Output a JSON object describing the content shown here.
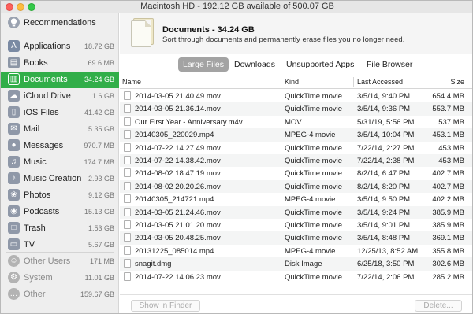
{
  "window": {
    "title": "Macintosh HD - 192.12 GB available of 500.07 GB"
  },
  "sidebar": {
    "recommendations": {
      "label": "Recommendations",
      "icon": "lightbulb-icon"
    },
    "items": [
      {
        "label": "Applications",
        "size": "18.72 GB",
        "icon": "applications-icon",
        "color": "#7a8aa3"
      },
      {
        "label": "Books",
        "size": "69.6 MB",
        "icon": "books-icon",
        "color": "#8c96a6"
      },
      {
        "label": "Documents",
        "size": "34.24 GB",
        "icon": "documents-icon",
        "color": "#ffffff"
      },
      {
        "label": "iCloud Drive",
        "size": "1.6 GB",
        "icon": "cloud-icon",
        "color": "#8f98a8"
      },
      {
        "label": "iOS Files",
        "size": "41.42 GB",
        "icon": "phone-icon",
        "color": "#8f98a8"
      },
      {
        "label": "Mail",
        "size": "5.35 GB",
        "icon": "mail-icon",
        "color": "#8f98a8"
      },
      {
        "label": "Messages",
        "size": "970.7 MB",
        "icon": "messages-icon",
        "color": "#8f98a8"
      },
      {
        "label": "Music",
        "size": "174.7 MB",
        "icon": "music-icon",
        "color": "#8f98a8"
      },
      {
        "label": "Music Creation",
        "size": "2.93 GB",
        "icon": "guitar-icon",
        "color": "#8f98a8"
      },
      {
        "label": "Photos",
        "size": "9.12 GB",
        "icon": "photos-icon",
        "color": "#8f98a8"
      },
      {
        "label": "Podcasts",
        "size": "15.13 GB",
        "icon": "podcasts-icon",
        "color": "#8f98a8"
      },
      {
        "label": "Trash",
        "size": "1.53 GB",
        "icon": "trash-icon",
        "color": "#8f98a8"
      },
      {
        "label": "TV",
        "size": "5.67 GB",
        "icon": "tv-icon",
        "color": "#8f98a8"
      }
    ],
    "other_items": [
      {
        "label": "Other Users",
        "size": "171 MB",
        "icon": "users-icon"
      },
      {
        "label": "System",
        "size": "11.01 GB",
        "icon": "gear-icon"
      },
      {
        "label": "Other",
        "size": "159.67 GB",
        "icon": "other-icon"
      }
    ],
    "active_color": "#31ae49"
  },
  "header": {
    "title": "Documents - 34.24 GB",
    "description": "Sort through documents and permanently erase files you no longer need."
  },
  "tabs": [
    {
      "label": "Large Files",
      "active": true
    },
    {
      "label": "Downloads",
      "active": false
    },
    {
      "label": "Unsupported Apps",
      "active": false
    },
    {
      "label": "File Browser",
      "active": false
    }
  ],
  "table": {
    "columns": {
      "name": "Name",
      "kind": "Kind",
      "last_accessed": "Last Accessed",
      "size": "Size"
    },
    "rows": [
      {
        "name": "2014-03-05 21.40.49.mov",
        "kind": "QuickTime movie",
        "date": "3/5/14, 9:40 PM",
        "size": "654.4 MB"
      },
      {
        "name": "2014-03-05 21.36.14.mov",
        "kind": "QuickTime movie",
        "date": "3/5/14, 9:36 PM",
        "size": "553.7 MB"
      },
      {
        "name": "Our First Year - Anniversary.m4v",
        "kind": "MOV",
        "date": "5/31/19, 5:56 PM",
        "size": "537 MB"
      },
      {
        "name": "20140305_220029.mp4",
        "kind": "MPEG-4 movie",
        "date": "3/5/14, 10:04 PM",
        "size": "453.1 MB"
      },
      {
        "name": "2014-07-22 14.27.49.mov",
        "kind": "QuickTime movie",
        "date": "7/22/14, 2:27 PM",
        "size": "453 MB"
      },
      {
        "name": "2014-07-22 14.38.42.mov",
        "kind": "QuickTime movie",
        "date": "7/22/14, 2:38 PM",
        "size": "453 MB"
      },
      {
        "name": "2014-08-02 18.47.19.mov",
        "kind": "QuickTime movie",
        "date": "8/2/14, 6:47 PM",
        "size": "402.7 MB"
      },
      {
        "name": "2014-08-02 20.20.26.mov",
        "kind": "QuickTime movie",
        "date": "8/2/14, 8:20 PM",
        "size": "402.7 MB"
      },
      {
        "name": "20140305_214721.mp4",
        "kind": "MPEG-4 movie",
        "date": "3/5/14, 9:50 PM",
        "size": "402.2 MB"
      },
      {
        "name": "2014-03-05 21.24.46.mov",
        "kind": "QuickTime movie",
        "date": "3/5/14, 9:24 PM",
        "size": "385.9 MB"
      },
      {
        "name": "2014-03-05 21.01.20.mov",
        "kind": "QuickTime movie",
        "date": "3/5/14, 9:01 PM",
        "size": "385.9 MB"
      },
      {
        "name": "2014-03-05 20.48.25.mov",
        "kind": "QuickTime movie",
        "date": "3/5/14, 8:48 PM",
        "size": "369.1 MB"
      },
      {
        "name": "20131225_085014.mp4",
        "kind": "MPEG-4 movie",
        "date": "12/25/13, 8:52 AM",
        "size": "355.8 MB"
      },
      {
        "name": "snagit.dmg",
        "kind": "Disk Image",
        "date": "6/25/18, 3:50 PM",
        "size": "302.6 MB"
      },
      {
        "name": "2014-07-22 14.06.23.mov",
        "kind": "QuickTime movie",
        "date": "7/22/14, 2:06 PM",
        "size": "285.2 MB"
      }
    ]
  },
  "footer": {
    "show_in_finder": "Show in Finder",
    "delete": "Delete..."
  }
}
